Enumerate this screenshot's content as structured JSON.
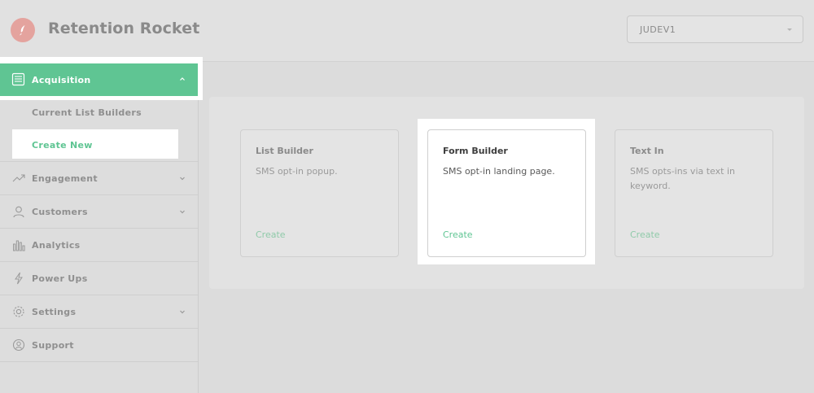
{
  "header": {
    "brand": "Retention Rocket",
    "account": "JUDEV1"
  },
  "sidebar": {
    "acquisition": {
      "label": "Acquisition",
      "sub_items": [
        "Current List Builders",
        "Create New"
      ]
    },
    "items": [
      {
        "label": "Engagement",
        "icon": "trend-icon",
        "expandable": true
      },
      {
        "label": "Customers",
        "icon": "user-icon",
        "expandable": true
      },
      {
        "label": "Analytics",
        "icon": "bar-chart-icon",
        "expandable": false
      },
      {
        "label": "Power Ups",
        "icon": "bolt-icon",
        "expandable": false
      },
      {
        "label": "Settings",
        "icon": "gear-icon",
        "expandable": true
      },
      {
        "label": "Support",
        "icon": "support-icon",
        "expandable": false
      }
    ]
  },
  "cards": [
    {
      "title": "List Builder",
      "desc": "SMS opt-in popup.",
      "action": "Create"
    },
    {
      "title": "Form Builder",
      "desc": "SMS opt-in landing page.",
      "action": "Create"
    },
    {
      "title": "Text In",
      "desc": "SMS opts-ins via text in keyword.",
      "action": "Create"
    }
  ],
  "colors": {
    "accent": "#5fc593",
    "logo": "#e4a39e"
  }
}
